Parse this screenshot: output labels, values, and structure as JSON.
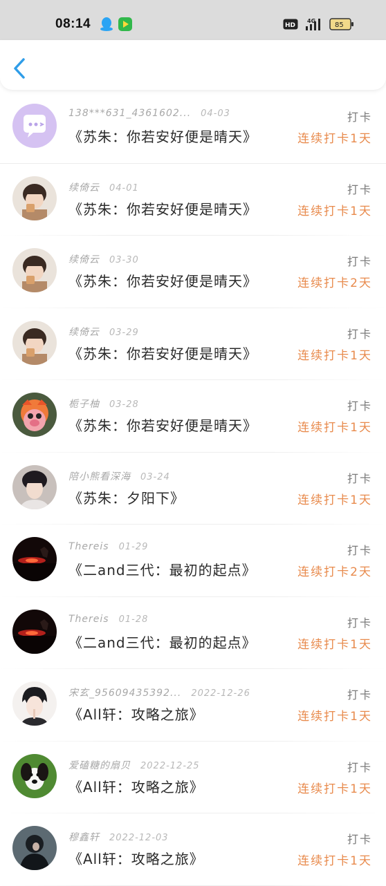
{
  "status_bar": {
    "time": "08:14",
    "hd_label": "HD",
    "network": "4G",
    "battery": "85",
    "icons": [
      "qq-icon",
      "video-app-icon",
      "hd-icon",
      "signal-icon",
      "battery-icon"
    ]
  },
  "nav": {
    "back_icon": "chevron-left-icon"
  },
  "records": [
    {
      "user": "138***631_4361602...",
      "date": "04-03",
      "title": "《苏朱：你若安好便是晴天》",
      "label": "打卡",
      "streak": "连续打卡1天",
      "avatar": "chat-bubble"
    },
    {
      "user": "续倚云",
      "date": "04-01",
      "title": "《苏朱：你若安好便是晴天》",
      "label": "打卡",
      "streak": "连续打卡1天",
      "avatar": "child"
    },
    {
      "user": "续倚云",
      "date": "03-30",
      "title": "《苏朱：你若安好便是晴天》",
      "label": "打卡",
      "streak": "连续打卡2天",
      "avatar": "child"
    },
    {
      "user": "续倚云",
      "date": "03-29",
      "title": "《苏朱：你若安好便是晴天》",
      "label": "打卡",
      "streak": "连续打卡1天",
      "avatar": "child"
    },
    {
      "user": "栀子柚",
      "date": "03-28",
      "title": "《苏朱：你若安好便是晴天》",
      "label": "打卡",
      "streak": "连续打卡1天",
      "avatar": "toy"
    },
    {
      "user": "陪小熊看深海",
      "date": "03-24",
      "title": "《苏朱：夕阳下》",
      "label": "打卡",
      "streak": "连续打卡1天",
      "avatar": "portrait"
    },
    {
      "user": "Thereis",
      "date": "01-29",
      "title": "《二and三代：最初的起点》",
      "label": "打卡",
      "streak": "连续打卡2天",
      "avatar": "sunset"
    },
    {
      "user": "Thereis",
      "date": "01-28",
      "title": "《二and三代：最初的起点》",
      "label": "打卡",
      "streak": "连续打卡1天",
      "avatar": "sunset"
    },
    {
      "user": "宋玄_95609435392...",
      "date": "2022-12-26",
      "title": "《All轩：攻略之旅》",
      "label": "打卡",
      "streak": "连续打卡1天",
      "avatar": "anime"
    },
    {
      "user": "爱磕糖的扇贝",
      "date": "2022-12-25",
      "title": "《All轩：攻略之旅》",
      "label": "打卡",
      "streak": "连续打卡1天",
      "avatar": "dog"
    },
    {
      "user": "穆鑫轩",
      "date": "2022-12-03",
      "title": "《All轩：攻略之旅》",
      "label": "打卡",
      "streak": "连续打卡1天",
      "avatar": "dark"
    }
  ],
  "colors": {
    "accent": "#2f9de8",
    "streak": "#e88a4c",
    "statusbar": "#dcdcdc"
  }
}
